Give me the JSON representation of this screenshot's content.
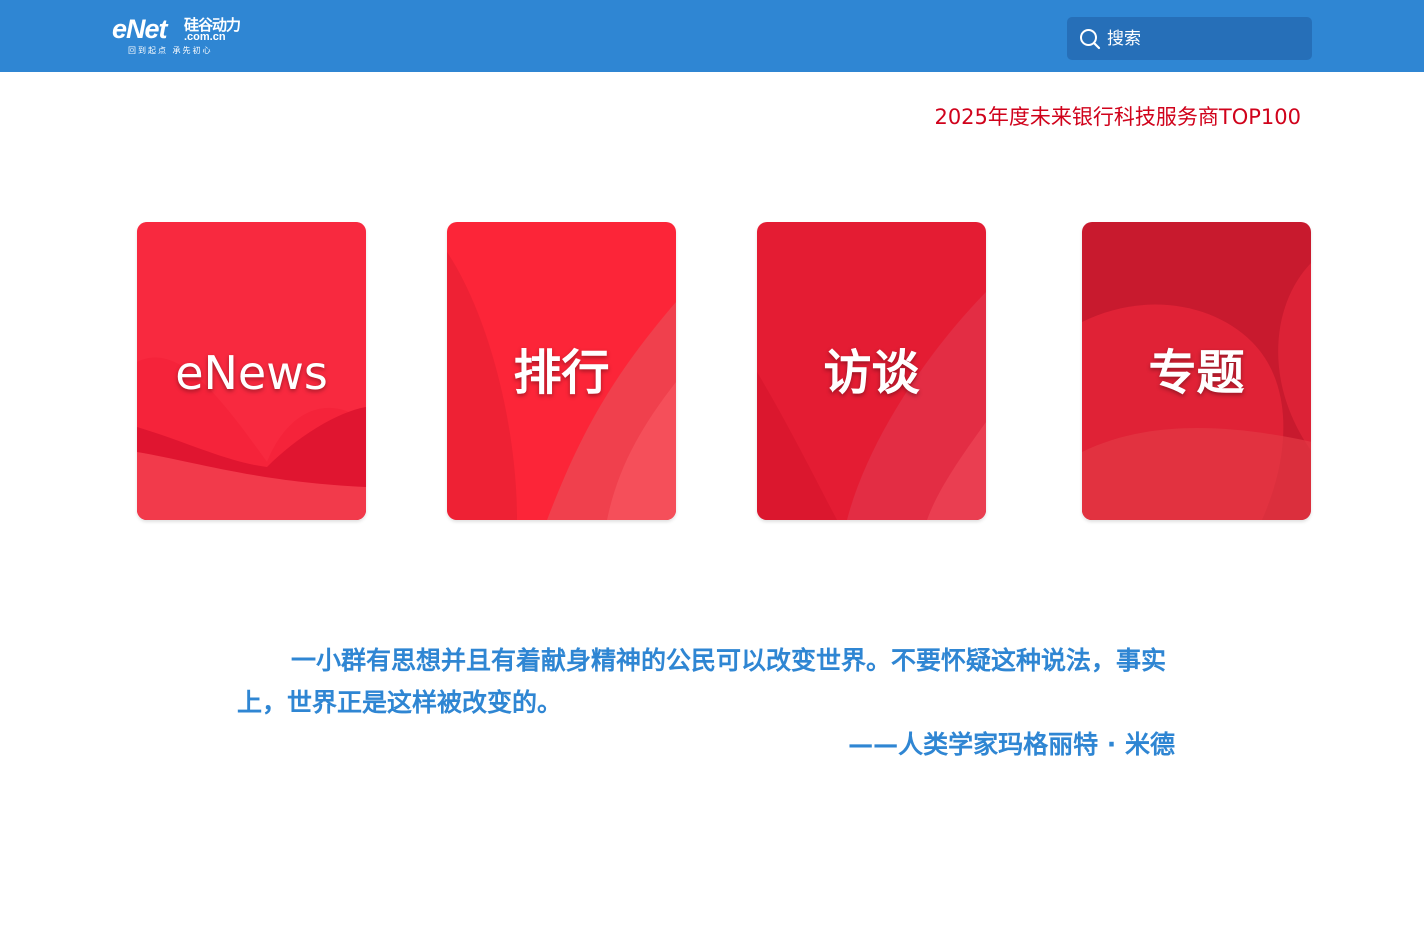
{
  "header": {
    "logo": {
      "main": "eNet",
      "cn_name": "硅谷动力",
      "domain": ".com.cn",
      "tagline": "回到起点 承先初心"
    },
    "search": {
      "placeholder": "搜索",
      "icon": "search-icon"
    }
  },
  "banner": {
    "link_text": "2025年度未来银行科技服务商TOP100",
    "color": "#d0021b"
  },
  "cards": [
    {
      "label": "eNews"
    },
    {
      "label": "排行"
    },
    {
      "label": "访谈"
    },
    {
      "label": "专题"
    }
  ],
  "quote": {
    "text": "一小群有思想并且有着献身精神的公民可以改变世界。不要怀疑这种说法，事实上，世界正是这样被改变的。",
    "author": "——人类学家玛格丽特 · 米德"
  },
  "colors": {
    "header_bg": "#2f86d3",
    "search_bg": "#266fb8",
    "card_red": "#e8213a",
    "quote_blue": "#2f86d3"
  }
}
